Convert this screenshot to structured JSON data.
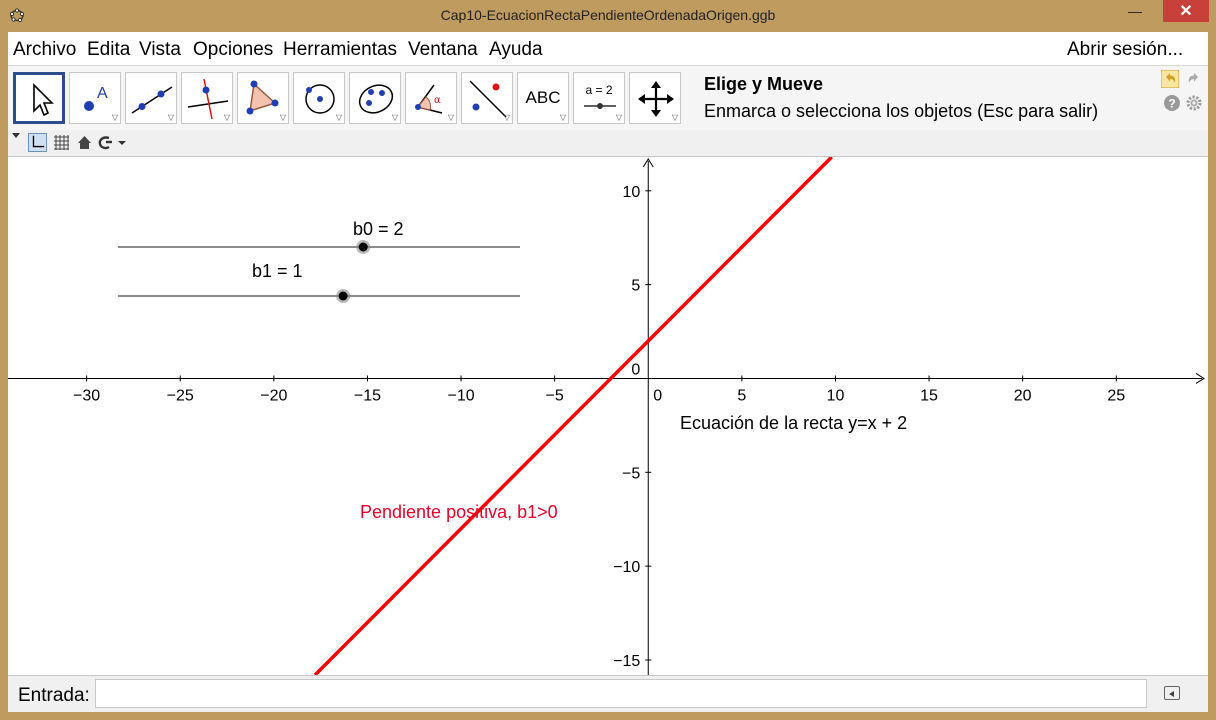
{
  "window": {
    "title": "Cap10-EcuacionRectaPendienteOrdenadaOrigen.ggb",
    "minimize": "—",
    "maximize": "☐",
    "close": "✕"
  },
  "menubar": {
    "items": [
      "Archivo",
      "Edita",
      "Vista",
      "Opciones",
      "Herramientas",
      "Ventana",
      "Ayuda"
    ],
    "sign_in": "Abrir sesión..."
  },
  "toolbar": {
    "tools": [
      "move-tool",
      "point-tool",
      "line-tool",
      "perpendicular-tool",
      "polygon-tool",
      "circle-tool",
      "conic-tool",
      "angle-tool",
      "reflect-tool",
      "text-tool",
      "slider-tool",
      "move-view-tool"
    ],
    "text_tool_label": "ABC",
    "slider_tool_label": "a = 2",
    "active_tool_title": "Elige y Mueve",
    "active_tool_help": "Enmarca o selecciona los objetos (Esc para salir)",
    "colors": {
      "active_border": "#2d4c8e",
      "undo": "#d2a028"
    }
  },
  "graphics": {
    "x_ticks": [
      "−30",
      "−25",
      "−20",
      "−15",
      "−10",
      "−5",
      "0",
      "5",
      "10",
      "15",
      "20",
      "25"
    ],
    "y_ticks": [
      "10",
      "5",
      "0",
      "−5",
      "−10",
      "−15"
    ],
    "x_tick_values": [
      -30,
      -25,
      -20,
      -15,
      -10,
      -5,
      0,
      5,
      10,
      15,
      20,
      25
    ],
    "y_tick_values": [
      10,
      5,
      0,
      -5,
      -10,
      -15
    ],
    "x_range": [
      -34.2,
      29.9
    ],
    "y_range": [
      -15.8,
      11.8
    ],
    "line": {
      "slope": 1,
      "intercept": 2,
      "color": "#ff0000"
    },
    "slider_b0": {
      "label": "b0 = 2",
      "value_fraction": 0.61
    },
    "slider_b1": {
      "label": "b1 = 1",
      "value_fraction": 0.56
    },
    "equation_text": "Ecuación de la recta y=x + 2",
    "slope_text": "Pendiente positiva, b1>0",
    "slope_text_color": "#e8002a"
  },
  "input_bar": {
    "label": "Entrada:",
    "value": "",
    "placeholder": ""
  }
}
